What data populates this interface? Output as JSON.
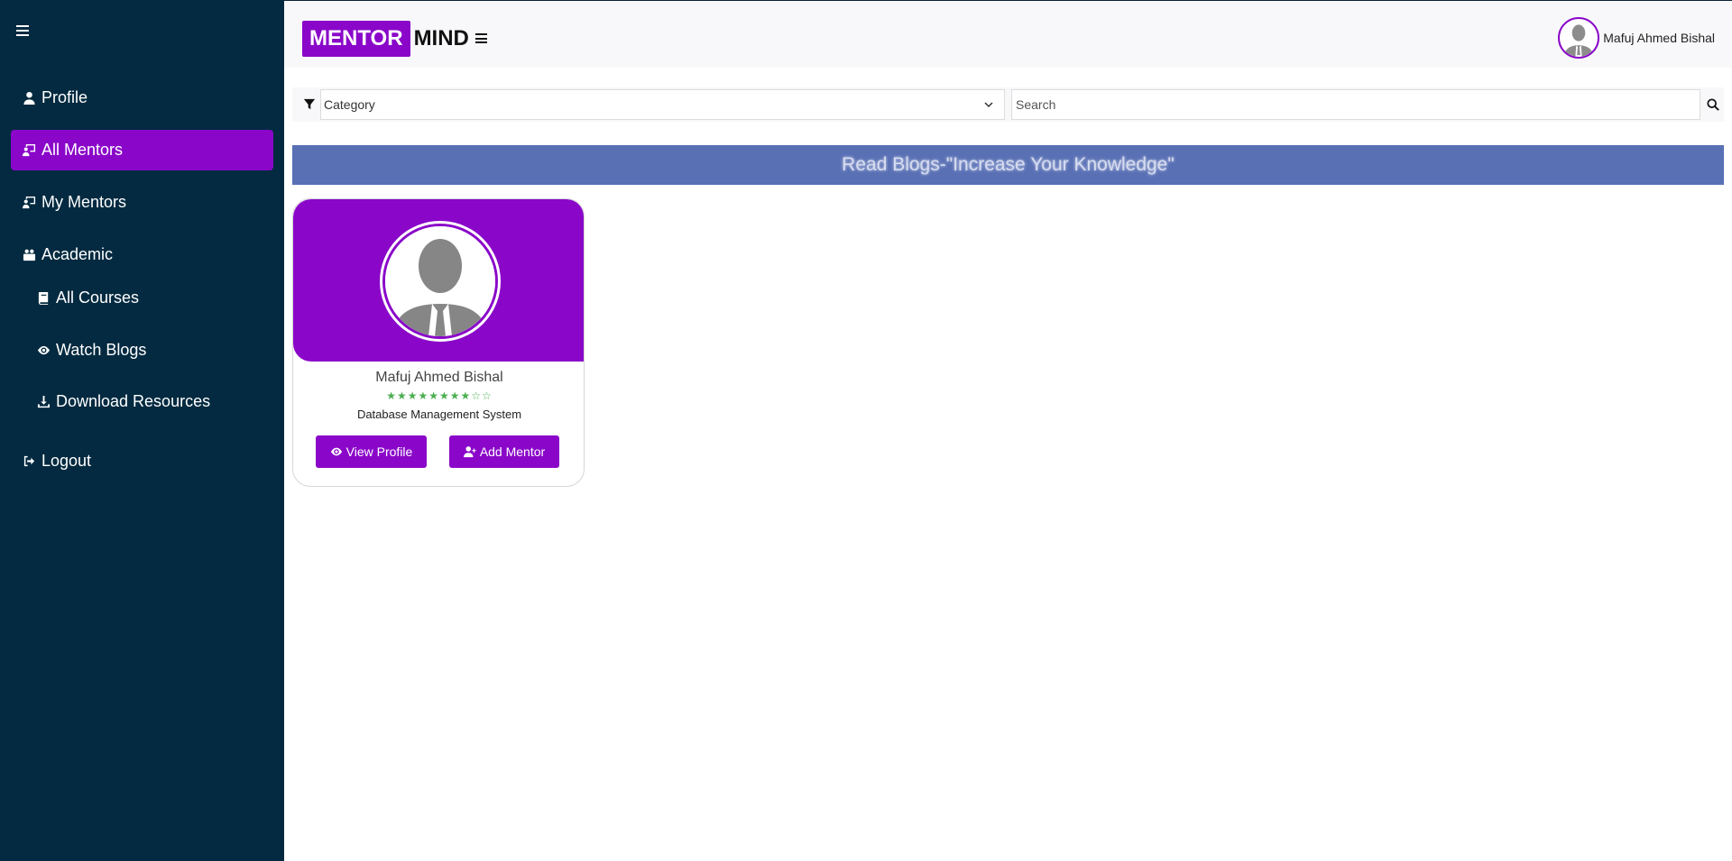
{
  "brand": {
    "part1": "MENTOR",
    "part2": "MIND",
    "accent": "#8a07c9"
  },
  "colors": {
    "sidebar_bg": "#032a40",
    "banner_bg": "#5970b5",
    "stars": "#4caf50"
  },
  "sidebar": {
    "items": [
      {
        "label": "Profile",
        "icon": "user-icon"
      },
      {
        "label": "All Mentors",
        "icon": "chalkboard-user-icon",
        "active": true
      },
      {
        "label": "My Mentors",
        "icon": "chalkboard-user-icon"
      },
      {
        "label": "Academic",
        "icon": "briefcase-users-icon"
      },
      {
        "label": "All Courses",
        "icon": "book-icon"
      },
      {
        "label": "Watch Blogs",
        "icon": "eye-icon"
      },
      {
        "label": "Download Resources",
        "icon": "download-icon"
      },
      {
        "label": "Logout",
        "icon": "logout-icon"
      }
    ]
  },
  "header": {
    "user_name": "Mafuj Ahmed Bishal"
  },
  "filters": {
    "category_value": "Category",
    "search_placeholder": "Search"
  },
  "banner": {
    "text": "Read Blogs-\"Increase Your Knowledge\""
  },
  "mentors": [
    {
      "name": "Mafuj Ahmed Bishal",
      "stars": "★★★★★★★★☆☆",
      "rating": 8,
      "rating_max": 10,
      "subject": "Database Management System",
      "view_label": "View Profile",
      "add_label": "Add Mentor"
    }
  ]
}
